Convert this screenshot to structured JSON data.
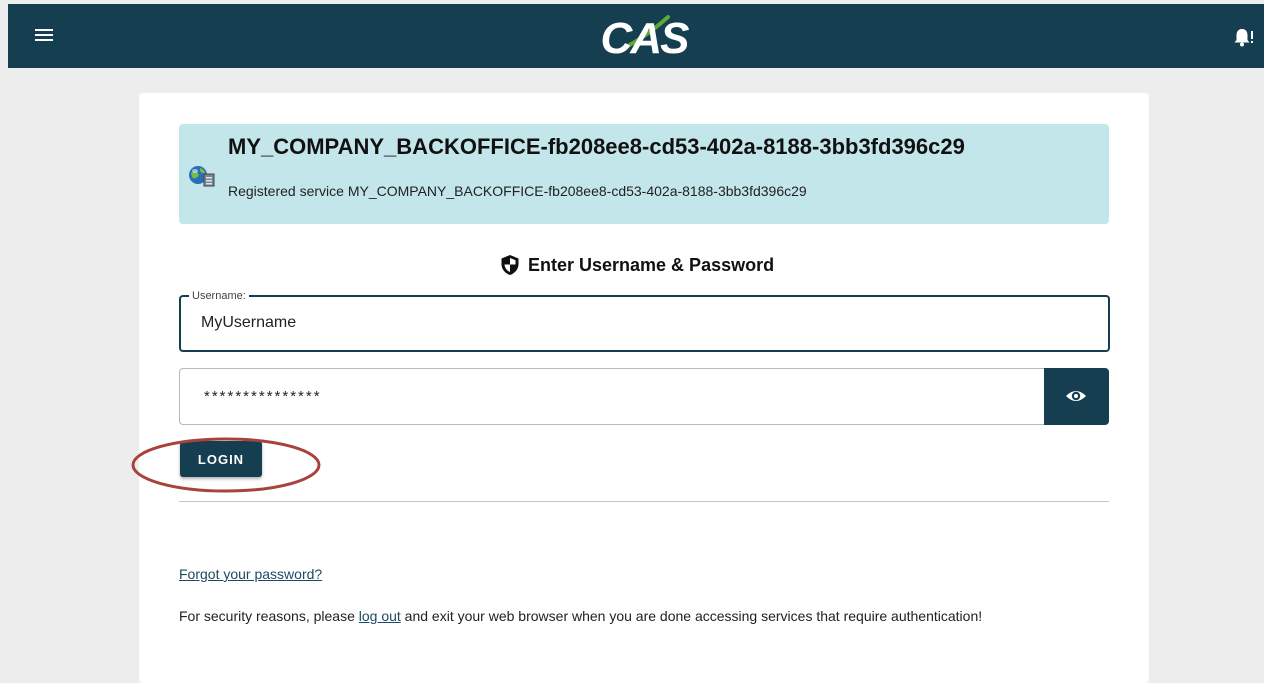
{
  "header": {
    "menu_icon": "menu-icon",
    "logo_text": "CAS",
    "notification_icon": "bell-icon"
  },
  "service": {
    "icon": "globe-server-icon",
    "title": "MY_COMPANY_BACKOFFICE-fb208ee8-cd53-402a-8188-3bb3fd396c29",
    "description": "Registered service MY_COMPANY_BACKOFFICE-fb208ee8-cd53-402a-8188-3bb3fd396c29"
  },
  "form": {
    "heading_icon": "shield-icon",
    "heading": "Enter Username & Password",
    "username_label": "Username:",
    "username_value": "MyUsername",
    "password_value": "***************",
    "show_password_icon": "eye-icon",
    "login_label": "LOGIN"
  },
  "footer": {
    "forgot_password": "Forgot your password?",
    "security_prefix": "For security reasons, please ",
    "logout_link": "log out",
    "security_suffix": " and exit your web browser when you are done accessing services that require authentication!"
  },
  "colors": {
    "header_bg": "#153e50",
    "service_box_bg": "#c3e6ea",
    "primary_button": "#153e50",
    "annotation_circle": "#a8423c",
    "page_bg": "#ededed"
  }
}
